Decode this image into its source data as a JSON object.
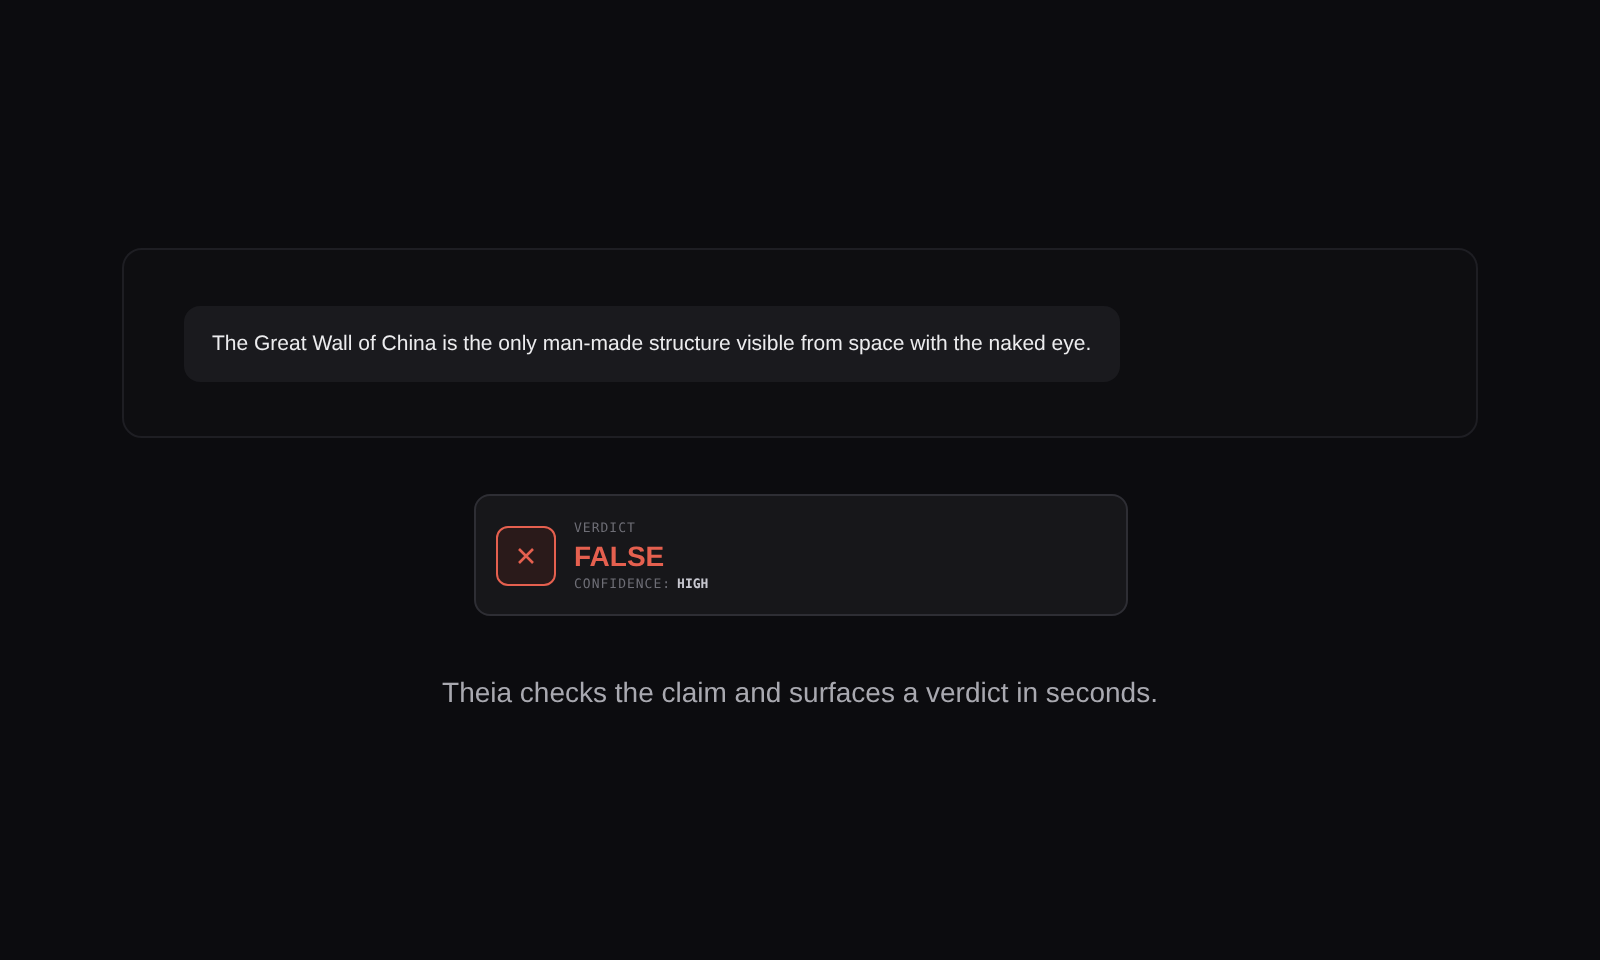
{
  "claim": {
    "text": "The Great Wall of China is the only man-made structure visible from space with the naked eye."
  },
  "verdict": {
    "label": "VERDICT",
    "kind": "false",
    "value": "FALSE",
    "confidence_label": "CONFIDENCE:",
    "confidence": "HIGH"
  },
  "caption": "Theia checks the claim and surfaces a verdict in seconds."
}
